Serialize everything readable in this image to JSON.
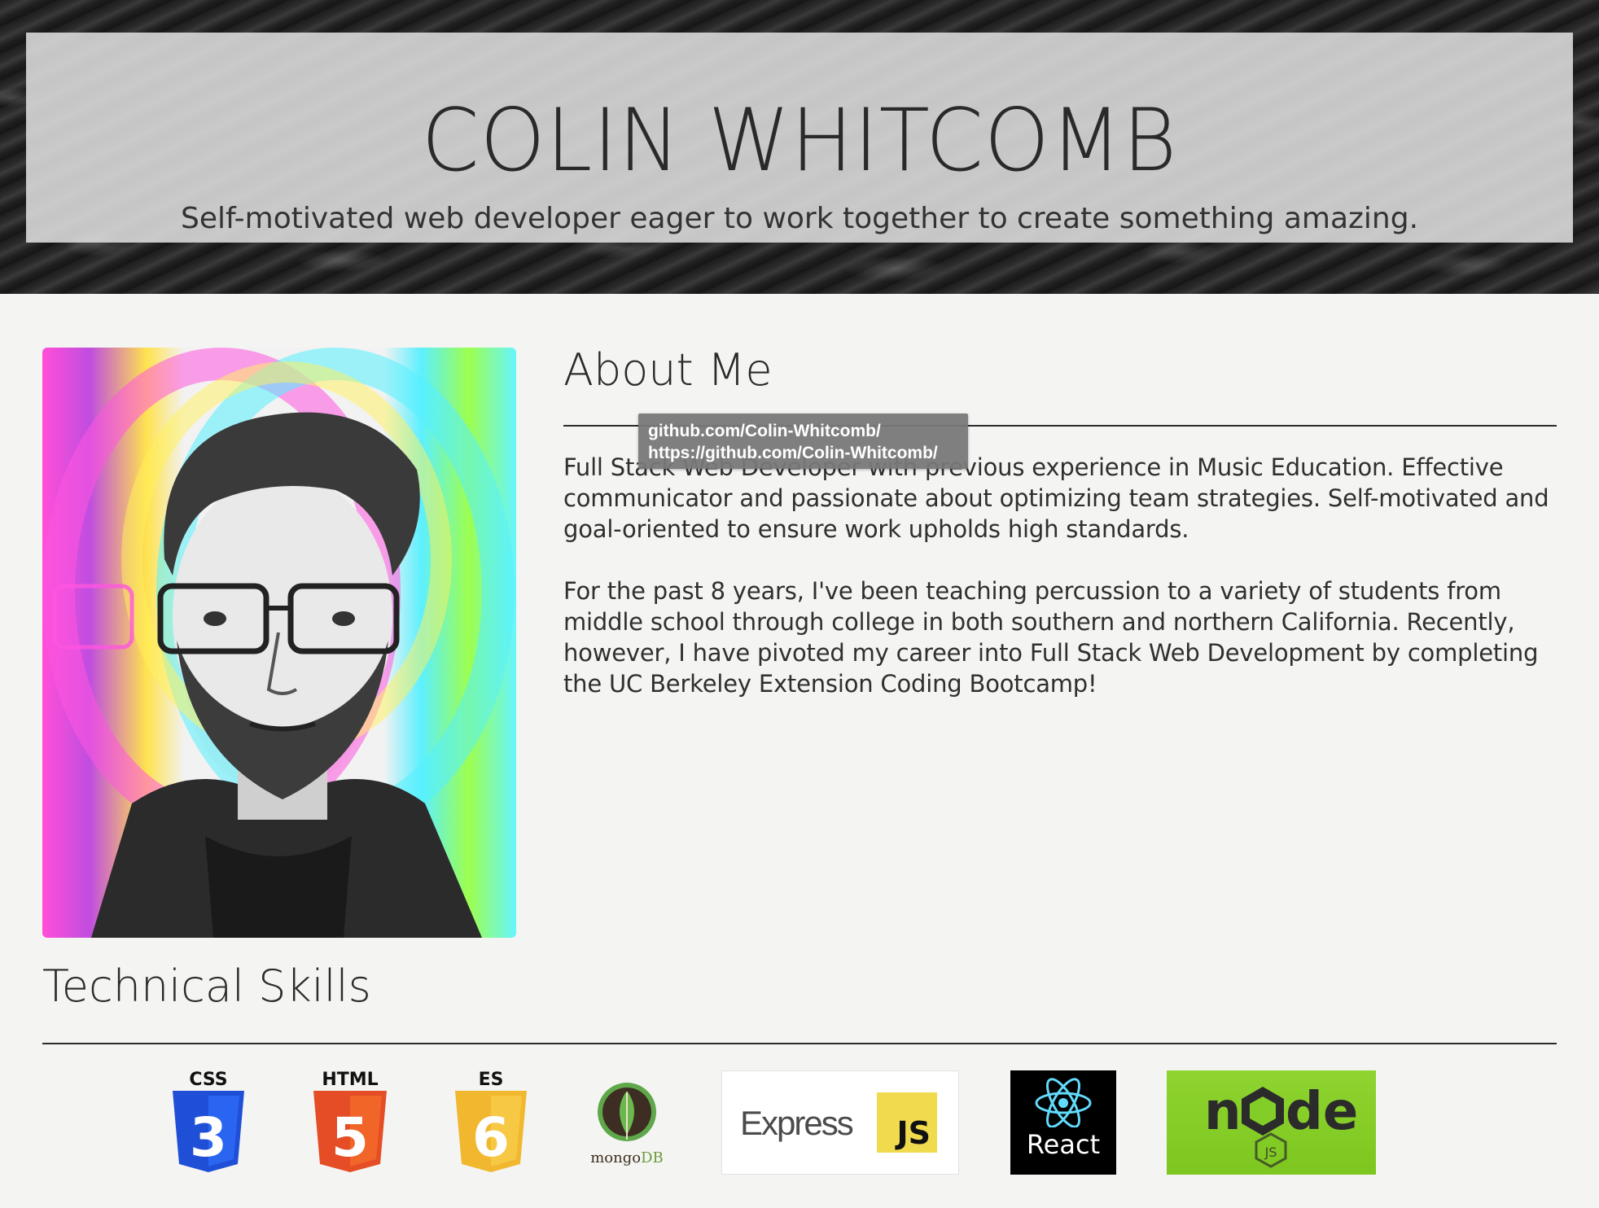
{
  "hero": {
    "name": "COLIN WHITCOMB",
    "tagline": "Self-motivated web developer eager to work together to create something amazing."
  },
  "portrait": {
    "icon": "profile-photo"
  },
  "about": {
    "title": "About Me",
    "paragraphs": [
      "Full Stack Web Developer with previous experience in Music Education. Effective communicator and passionate about optimizing team strategies. Self-motivated and goal-oriented to ensure work upholds high standards.",
      "For the past 8 years, I've been teaching percussion to a variety of students from middle school through college in both southern and northern California. Recently, however, I have pivoted my career into Full Stack Web Development by completing the UC Berkeley Extension Coding Bootcamp!"
    ]
  },
  "tooltip": {
    "line1": "github.com/Colin-Whitcomb/",
    "line2": "https://github.com/Colin-Whitcomb/"
  },
  "skills": {
    "title": "Technical Skills",
    "logos": {
      "css": {
        "label": "CSS",
        "number": "3",
        "color": "#2965f1"
      },
      "html": {
        "label": "HTML",
        "number": "5",
        "color": "#e44d26"
      },
      "es": {
        "label": "ES",
        "number": "6",
        "color": "#f7c843"
      },
      "mongo": {
        "label_mongo": "mongo",
        "label_db": "DB",
        "color": "#4fa94d"
      },
      "express": {
        "word": "Express",
        "js": "JS"
      },
      "react": {
        "label": "React",
        "color": "#61dafb"
      },
      "node": {
        "word_n": "n",
        "word_de": "de",
        "js": "JS",
        "color": "#83cd29"
      }
    }
  }
}
